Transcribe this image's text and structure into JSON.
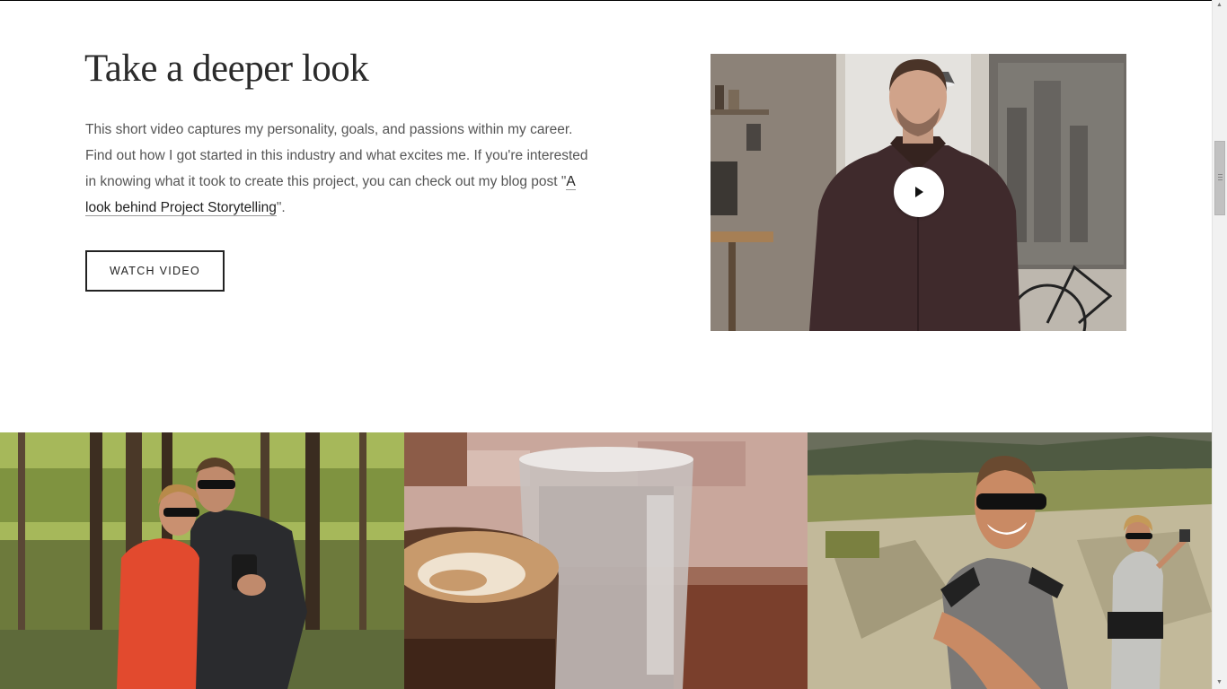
{
  "section": {
    "heading": "Take a deeper look",
    "description_before_link": "This short video captures my personality, goals, and passions within my career. Find out how I got started in this industry and what excites me. If you're interested in knowing what it took to create this project, you can check out my blog post \"",
    "link_text": "A look behind Project Storytelling",
    "description_after_link": "\".",
    "button_label": "WATCH VIDEO"
  },
  "video": {
    "play_icon": "play-icon"
  },
  "gallery": [
    {
      "name": "hiking-couple-forest-photo"
    },
    {
      "name": "latte-and-water-photo"
    },
    {
      "name": "mountain-selfie-photo"
    }
  ],
  "colors": {
    "text_dark": "#2b2b2b",
    "text_body": "#555555",
    "button_border": "#222222"
  }
}
